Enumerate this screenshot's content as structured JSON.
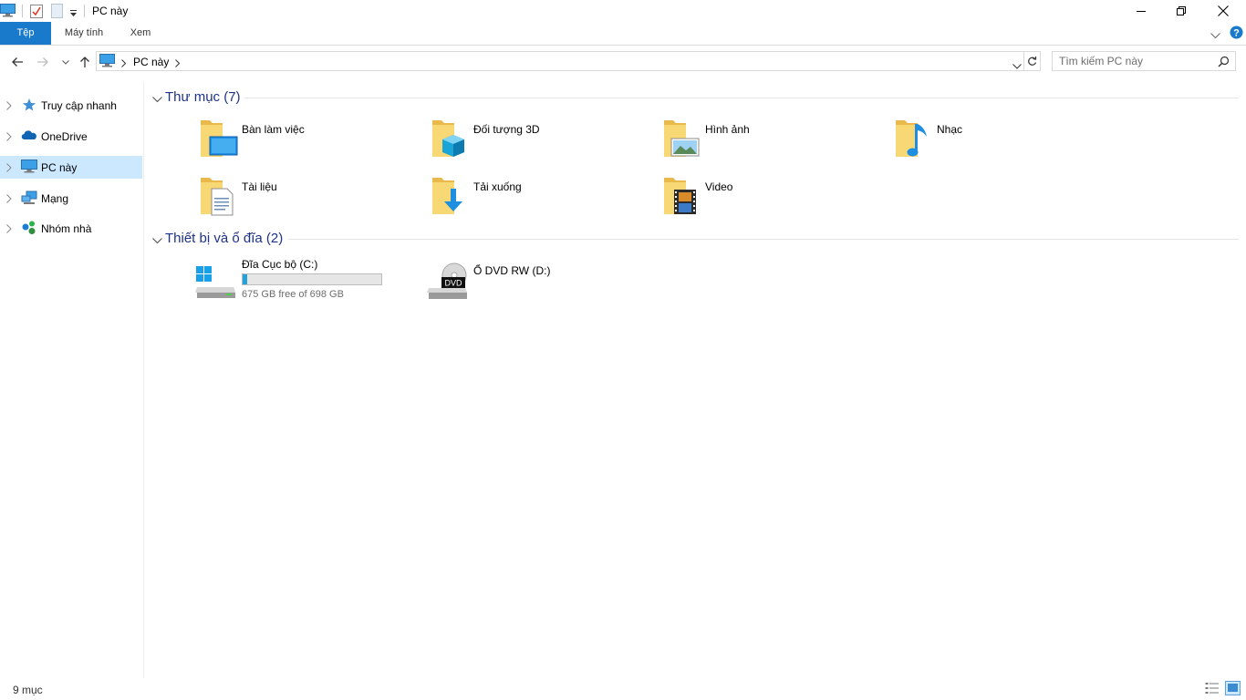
{
  "window": {
    "title": "PC này",
    "controls": {
      "minimize": "minimize-icon",
      "restore": "restore-icon",
      "close": "close-icon"
    }
  },
  "ribbon": {
    "tabs": [
      {
        "label": "Tệp",
        "active": true
      },
      {
        "label": "Máy tính"
      },
      {
        "label": "Xem"
      }
    ]
  },
  "address": {
    "breadcrumb": "PC này",
    "search_placeholder": "Tìm kiếm PC này"
  },
  "nav_pane": {
    "items": [
      {
        "label": "Truy cập nhanh",
        "icon": "star-icon"
      },
      {
        "label": "OneDrive",
        "icon": "cloud-icon"
      },
      {
        "label": "PC này",
        "icon": "computer-icon",
        "selected": true
      },
      {
        "label": "Mạng",
        "icon": "network-icon"
      },
      {
        "label": "Nhóm nhà",
        "icon": "homegroup-icon"
      }
    ]
  },
  "folders_group": {
    "title": "Thư mục (7)",
    "items": [
      {
        "label": "Bàn làm việc",
        "icon": "desktop-folder-icon"
      },
      {
        "label": "Đối tượng 3D",
        "icon": "3d-objects-folder-icon"
      },
      {
        "label": "Hình ảnh",
        "icon": "pictures-folder-icon"
      },
      {
        "label": "Nhạc",
        "icon": "music-folder-icon"
      },
      {
        "label": "Tài liệu",
        "icon": "documents-folder-icon"
      },
      {
        "label": "Tải xuống",
        "icon": "downloads-folder-icon"
      },
      {
        "label": "Video",
        "icon": "videos-folder-icon"
      }
    ]
  },
  "drives_group": {
    "title": "Thiết bị và ổ đĩa (2)",
    "items": [
      {
        "label": "Đĩa Cục bộ (C:)",
        "free_text": "675 GB free of 698 GB",
        "used_fraction": 0.033,
        "icon": "local-disk-icon"
      },
      {
        "label": "Ổ DVD RW (D:)",
        "icon": "dvd-drive-icon",
        "badge": "DVD"
      }
    ]
  },
  "status": {
    "count": "9 mục"
  },
  "colors": {
    "accent": "#1979ca",
    "selected": "#cce8ff",
    "group_title": "#1e3287",
    "folder": "#f8d775",
    "bar_fill": "#26a0da"
  }
}
